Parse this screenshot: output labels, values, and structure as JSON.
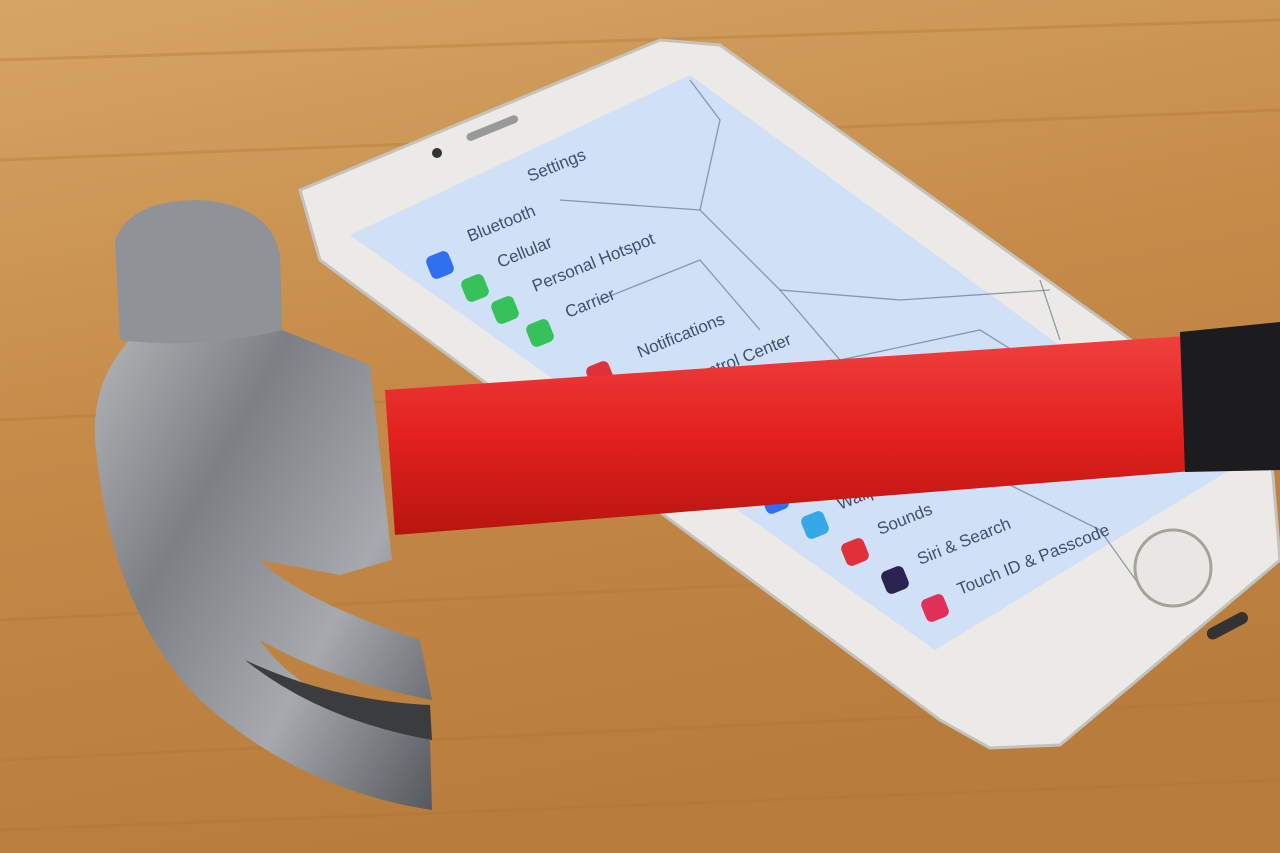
{
  "scene": {
    "colors": {
      "wood": "#c98f4e",
      "screen": "#cfe0f7",
      "handle": "#e8242a",
      "grip": "#1c1c1e",
      "steel": "#8c8f93",
      "phone_body": "#eceae6"
    },
    "objects": [
      "claw-hammer",
      "cracked-smartphone"
    ]
  },
  "phone_screen": {
    "title": "Settings",
    "rows": [
      {
        "label": "Bluetooth",
        "icon": "bluetooth-icon",
        "color": "#2f6ff0"
      },
      {
        "label": "Cellular",
        "icon": "cellular-icon",
        "color": "#35c25a"
      },
      {
        "label": "Personal Hotspot",
        "icon": "hotspot-icon",
        "color": "#35c25a"
      },
      {
        "label": "Carrier",
        "icon": "phone-icon",
        "color": "#35c25a"
      },
      {
        "label": "Notifications",
        "icon": "notifications-icon",
        "color": "#e0303a"
      },
      {
        "label": "Control Center",
        "icon": "control-center-icon",
        "color": "#8a8f99"
      },
      {
        "label": "Wallpaper",
        "icon": "display-icon",
        "color": "#2f6ff0"
      },
      {
        "label": "Sounds",
        "icon": "wallpaper-icon",
        "color": "#36a8e8"
      },
      {
        "label": "Siri & Search",
        "icon": "sounds-icon",
        "color": "#e0303a"
      },
      {
        "label": "Touch ID & Passcode",
        "icon": "siri-icon",
        "color": "#2a2350"
      }
    ],
    "extra_icon": {
      "icon": "fingerprint-icon",
      "color": "#e0305a"
    }
  }
}
